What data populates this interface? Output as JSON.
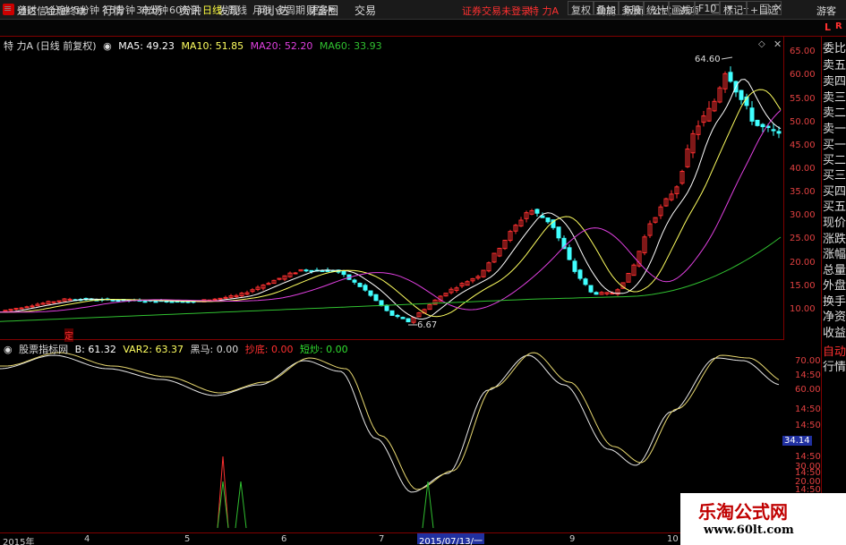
{
  "app": {
    "title": "通达信金融终端"
  },
  "menu": [
    "行情",
    "市场",
    "资讯",
    "发现",
    "问小达",
    "财富圈",
    "交易"
  ],
  "broker_status": "证券交易未登录",
  "stock_name": "特 力A",
  "right_menu": [
    "功能",
    "版面",
    "公式",
    "选项",
    "游客"
  ],
  "periods": [
    "分时",
    "1分钟",
    "5分钟",
    "15分钟",
    "30分钟",
    "60分钟",
    "日线",
    "周线",
    "月线",
    "多周期",
    "更多"
  ],
  "active_period": "日线",
  "tools": [
    "复权",
    "叠加",
    "多股",
    "统计",
    "画线",
    "F10",
    "标记",
    "+自选"
  ],
  "right_panel_top": "L",
  "right_panel_top2": "R",
  "right_panel_items": [
    "委比",
    "卖五",
    "卖四",
    "卖三",
    "卖二",
    "卖一",
    "买一",
    "买二",
    "买三",
    "买四",
    "买五",
    "现价",
    "涨跌",
    "涨幅",
    "总量",
    "外盘",
    "换手",
    "净资",
    "收益"
  ],
  "right_panel_lower": [
    "自动",
    "行情"
  ],
  "ma_legend": {
    "title": "特 力A (日线 前复权)",
    "ma5": "MA5: 49.23",
    "ma10": "MA10: 51.85",
    "ma20": "MA20: 52.20",
    "ma60": "MA60: 33.93"
  },
  "price_axis": [
    "65.00",
    "60.00",
    "55.00",
    "50.00",
    "45.00",
    "40.00",
    "35.00",
    "30.00",
    "25.00",
    "20.00",
    "15.00",
    "10.00"
  ],
  "high_label": "64.60",
  "low_label": "6.67",
  "event_marker": "定",
  "indicator_legend": {
    "name": "股票指标网",
    "b": "B: 61.32",
    "var2": "VAR2: 63.37",
    "heima": "黑马: 0.00",
    "chaodi": "抄底: 0.00",
    "duanchao": "短炒: 0.00"
  },
  "indicator_axis": [
    "70.00",
    "14:50",
    "60.00",
    "14:50",
    "14:50",
    "14:50",
    "30.00",
    "14:50",
    "20.00",
    "14:50"
  ],
  "cursor_value": "34.14",
  "time_axis": [
    "2015年",
    "4",
    "5",
    "6",
    "7",
    "9",
    "10"
  ],
  "time_cursor": "2015/07/13/一",
  "watermark": {
    "title": "乐淘公式网",
    "url": "www.60lt.com"
  },
  "colors": {
    "up": "#ff3030",
    "down": "#40ffff",
    "ma5": "#ffffff",
    "ma10": "#ffff60",
    "ma20": "#e040e0",
    "ma60": "#30c030",
    "grid": "#800000"
  }
}
